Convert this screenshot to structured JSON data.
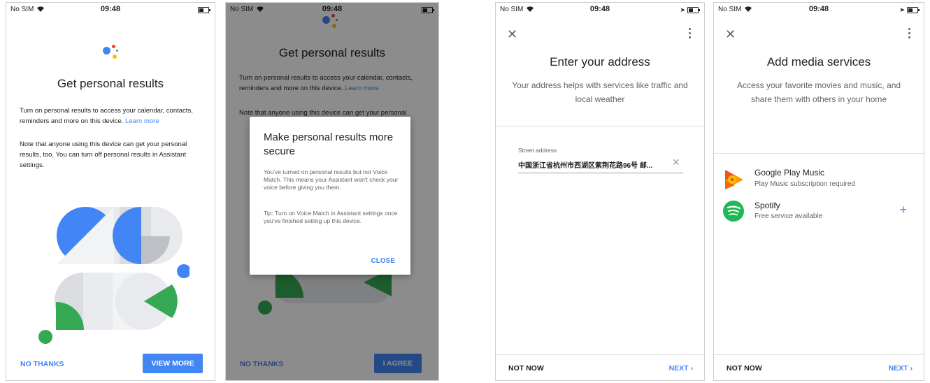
{
  "status": {
    "carrier": "No SIM",
    "time": "09:48"
  },
  "colors": {
    "accent": "#4285f4",
    "google_blue": "#4285f4",
    "google_red": "#ea4335",
    "google_yellow": "#fbbc05",
    "google_green": "#34a853",
    "spotify_green": "#1db954"
  },
  "screen1": {
    "title": "Get personal results",
    "paragraph1": "Turn on personal results to access your calendar, contacts, reminders and more on this device.",
    "learn_more": "Learn more",
    "paragraph2": "Note that anyone using this device can get your personal results, too. You can turn off personal results in Assistant settings.",
    "no_thanks": "NO THANKS",
    "view_more": "VIEW MORE"
  },
  "screen2": {
    "title": "Get personal results",
    "paragraph1": "Turn on personal results to access your calendar, contacts, reminders and more on this device.",
    "learn_more": "Learn more",
    "paragraph2_partial": "Note that anyone using this device can get your personal",
    "dialog": {
      "title": "Make personal results more secure",
      "body1": "You've turned on personal results but not Voice Match. This means your Assistant won't check your voice before giving you them.",
      "body2": "Tip: Turn on Voice Match in Assistant settings once you've finished setting up this device.",
      "close": "CLOSE"
    },
    "no_thanks": "NO THANKS",
    "agree": "I AGREE"
  },
  "screen3": {
    "title": "Enter your address",
    "subtitle": "Your address helps with services like traffic and local weather",
    "field_label": "Street address",
    "field_value": "中国浙江省杭州市西湖区紫荆花路96号 邮...",
    "not_now": "NOT NOW",
    "next": "NEXT"
  },
  "screen4": {
    "title": "Add media services",
    "subtitle": "Access your favorite movies and music, and share them with others in your home",
    "services": [
      {
        "name": "Google Play Music",
        "detail": "Play Music subscription required",
        "icon": "google-play-music-icon"
      },
      {
        "name": "Spotify",
        "detail": "Free service available",
        "icon": "spotify-icon"
      }
    ],
    "not_now": "NOT NOW",
    "next": "NEXT"
  }
}
